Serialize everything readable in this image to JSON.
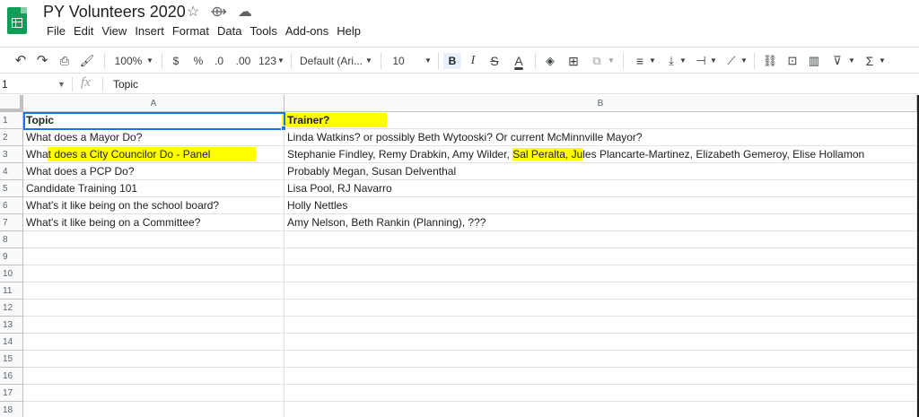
{
  "app": {
    "title": "PY Volunteers 2020",
    "accent_color": "#0f9d58",
    "title_icons": [
      "star-icon",
      "move-to-folder-icon",
      "cloud-status-icon"
    ]
  },
  "menu": [
    "File",
    "Edit",
    "View",
    "Insert",
    "Format",
    "Data",
    "Tools",
    "Add-ons",
    "Help"
  ],
  "toolbar": {
    "zoom": "100%",
    "currency": "$",
    "percent": "%",
    "decrease_decimals": ".0",
    "increase_decimals": ".00",
    "more_formats": "123",
    "font": "Default (Ari...",
    "font_size": "10",
    "bold": "B",
    "italic": "I",
    "strikethrough": "S",
    "text_color": "A",
    "sum": "Σ"
  },
  "formula_bar": {
    "cell_ref": "1",
    "fx": "fx",
    "value": "Topic"
  },
  "columns": [
    "A",
    "B"
  ],
  "rows": [
    {
      "num": "1",
      "a": "Topic",
      "b": "Trainer?"
    },
    {
      "num": "2",
      "a": "What does a Mayor Do?",
      "b": "Linda Watkins?  or possibly Beth Wytooski?  Or current McMinnville Mayor?"
    },
    {
      "num": "3",
      "a": "What does a City Councilor Do - Panel",
      "b_parts": [
        "Stephanie Findley, Remy Drabkin, Amy Wilder, ",
        "Sal Peralta, Ju",
        "les Plancarte-Martinez, Elizabeth Gemeroy, Elise Hollamon"
      ]
    },
    {
      "num": "4",
      "a": "What does a PCP Do?",
      "b": "Probably Megan, Susan Delventhal"
    },
    {
      "num": "5",
      "a": "Candidate Training 101",
      "b": "Lisa Pool, RJ Navarro"
    },
    {
      "num": "6",
      "a": "What's it like being on the school board?",
      "b": "Holly Nettles"
    },
    {
      "num": "7",
      "a": "What's it like being on a Committee?",
      "b": "Amy Nelson, Beth Rankin (Planning), ???"
    },
    {
      "num": "8",
      "a": "",
      "b": ""
    },
    {
      "num": "9",
      "a": "",
      "b": ""
    },
    {
      "num": "10",
      "a": "",
      "b": ""
    },
    {
      "num": "11",
      "a": "",
      "b": ""
    },
    {
      "num": "12",
      "a": "",
      "b": ""
    },
    {
      "num": "13",
      "a": "",
      "b": ""
    },
    {
      "num": "14",
      "a": "",
      "b": ""
    },
    {
      "num": "15",
      "a": "",
      "b": ""
    },
    {
      "num": "16",
      "a": "",
      "b": ""
    },
    {
      "num": "17",
      "a": "",
      "b": ""
    },
    {
      "num": "18",
      "a": "",
      "b": ""
    }
  ],
  "highlight_color": "#ffff00",
  "selection_color": "#1a73e8"
}
